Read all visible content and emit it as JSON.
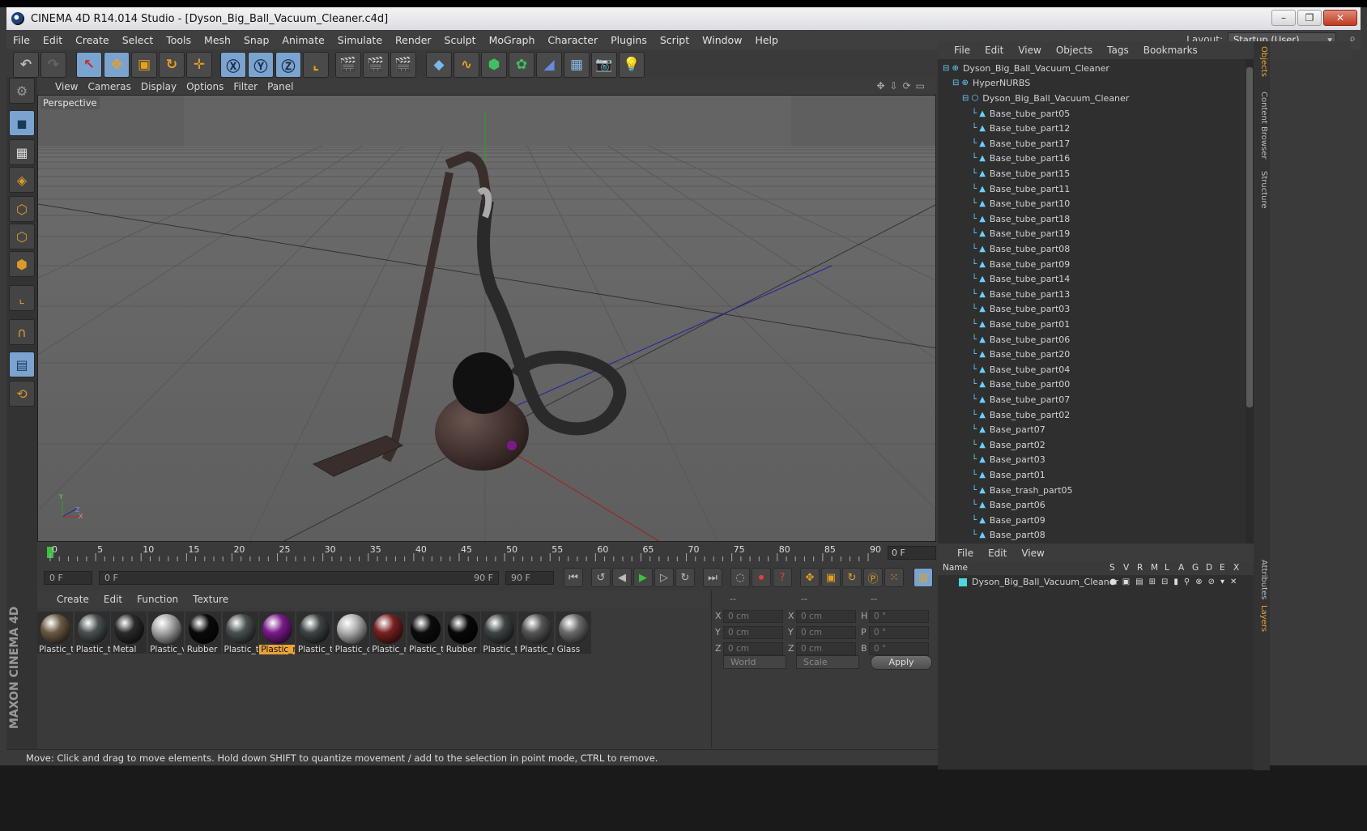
{
  "window": {
    "title": "CINEMA 4D R14.014 Studio - [Dyson_Big_Ball_Vacuum_Cleaner.c4d]",
    "buttons": [
      "–",
      "❐",
      "✕"
    ]
  },
  "menubar": {
    "items": [
      "File",
      "Edit",
      "Create",
      "Select",
      "Tools",
      "Mesh",
      "Snap",
      "Animate",
      "Simulate",
      "Render",
      "Sculpt",
      "MoGraph",
      "Character",
      "Plugins",
      "Script",
      "Window",
      "Help"
    ],
    "layout_label": "Layout:",
    "layout_value": "Startup (User)"
  },
  "viewport": {
    "menu": [
      "View",
      "Cameras",
      "Display",
      "Options",
      "Filter",
      "Panel"
    ],
    "camera_label": "Perspective",
    "axis_labels": [
      "Y",
      "Z",
      "X"
    ]
  },
  "timeline": {
    "ticks": [
      "0",
      "5",
      "10",
      "15",
      "20",
      "25",
      "30",
      "35",
      "40",
      "45",
      "50",
      "55",
      "60",
      "65",
      "70",
      "75",
      "80",
      "85",
      "90"
    ],
    "current_frame": "0 F",
    "start_field": "0 F",
    "range_start": "0 F",
    "range_end": "90 F",
    "end_field": "90 F"
  },
  "materials": {
    "menu": [
      "Create",
      "Edit",
      "Function",
      "Texture"
    ],
    "items": [
      {
        "label": "Plastic_t",
        "color": "#6a5a44"
      },
      {
        "label": "Plastic_t",
        "color": "#4a5052"
      },
      {
        "label": "Metal",
        "color": "#2a2a2a"
      },
      {
        "label": "Plastic_v",
        "color": "#a8a8a8"
      },
      {
        "label": "Rubber",
        "color": "#0a0a0a"
      },
      {
        "label": "Plastic_t",
        "color": "#4a5052"
      },
      {
        "label": "Plastic_r",
        "color": "#7a1a8a",
        "selected": true
      },
      {
        "label": "Plastic_t",
        "color": "#3e4446"
      },
      {
        "label": "Plastic_c",
        "color": "#b0b0b0"
      },
      {
        "label": "Plastic_r",
        "color": "#7a2020"
      },
      {
        "label": "Plastic_t",
        "color": "#0c0c0c"
      },
      {
        "label": "Rubber",
        "color": "#080808"
      },
      {
        "label": "Plastic_t",
        "color": "#3e4446"
      },
      {
        "label": "Plastic_r",
        "color": "#555555"
      },
      {
        "label": "Glass",
        "color": "#6a6a6a"
      }
    ]
  },
  "coordinates": {
    "headers": [
      "--",
      "--",
      "--"
    ],
    "rows": [
      {
        "a": "X",
        "av": "0 cm",
        "b": "X",
        "bv": "0 cm",
        "c": "H",
        "cv": "0 °"
      },
      {
        "a": "Y",
        "av": "0 cm",
        "b": "Y",
        "bv": "0 cm",
        "c": "P",
        "cv": "0 °"
      },
      {
        "a": "Z",
        "av": "0 cm",
        "b": "Z",
        "bv": "0 cm",
        "c": "B",
        "cv": "0 °"
      }
    ],
    "space": "World",
    "mode": "Scale",
    "apply": "Apply"
  },
  "status": "Move: Click and drag to move elements. Hold down SHIFT to quantize movement / add to the selection in point mode, CTRL to remove.",
  "objects": {
    "menu": [
      "File",
      "Edit",
      "View",
      "Objects",
      "Tags",
      "Bookmarks"
    ],
    "items": [
      {
        "name": "Dyson_Big_Ball_Vacuum_Cleaner",
        "indent": 0,
        "tag": "#4dd4e0"
      },
      {
        "name": "HyperNURBS",
        "indent": 1,
        "tag": "check"
      },
      {
        "name": "Dyson_Big_Ball_Vacuum_Cleaner",
        "indent": 2,
        "tag": ""
      },
      {
        "name": "Base_tube_part05",
        "indent": 3,
        "tag": "#444a4c"
      },
      {
        "name": "Base_tube_part12",
        "indent": 3,
        "tag": "#3c4244"
      },
      {
        "name": "Base_tube_part17",
        "indent": 3,
        "tag": "#0a0a0a"
      },
      {
        "name": "Base_tube_part16",
        "indent": 3,
        "tag": "#9a9a9a"
      },
      {
        "name": "Base_tube_part15",
        "indent": 3,
        "tag": "#0a0a0a"
      },
      {
        "name": "Base_tube_part11",
        "indent": 3,
        "tag": "#3c4244"
      },
      {
        "name": "Base_tube_part10",
        "indent": 3,
        "tag": "#3c4244"
      },
      {
        "name": "Base_tube_part18",
        "indent": 3,
        "tag": "#0a0a0a"
      },
      {
        "name": "Base_tube_part19",
        "indent": 3,
        "tag": "#7a1a8a"
      },
      {
        "name": "Base_tube_part08",
        "indent": 3,
        "tag": "#3c4244"
      },
      {
        "name": "Base_tube_part09",
        "indent": 3,
        "tag": "#7a1a8a"
      },
      {
        "name": "Base_tube_part14",
        "indent": 3,
        "tag": "#9a9a9a"
      },
      {
        "name": "Base_tube_part13",
        "indent": 3,
        "tag": "#3c4244"
      },
      {
        "name": "Base_tube_part03",
        "indent": 3,
        "tag": "#3c4244"
      },
      {
        "name": "Base_tube_part01",
        "indent": 3,
        "tag": "#9a9a9a"
      },
      {
        "name": "Base_tube_part06",
        "indent": 3,
        "tag": "#7a1a8a"
      },
      {
        "name": "Base_tube_part20",
        "indent": 3,
        "tag": "#3c4244"
      },
      {
        "name": "Base_tube_part04",
        "indent": 3,
        "tag": "#3c4244"
      },
      {
        "name": "Base_tube_part00",
        "indent": 3,
        "tag": "#9a9a9a"
      },
      {
        "name": "Base_tube_part07",
        "indent": 3,
        "tag": "#3c4244"
      },
      {
        "name": "Base_tube_part02",
        "indent": 3,
        "tag": "#0a0a0a"
      },
      {
        "name": "Base_part07",
        "indent": 3,
        "tag": "#0a0a0a"
      },
      {
        "name": "Base_part02",
        "indent": 3,
        "tag": "#0a0a0a"
      },
      {
        "name": "Base_part03",
        "indent": 3,
        "tag": "#3c4244"
      },
      {
        "name": "Base_part01",
        "indent": 3,
        "tag": "#3c4244"
      },
      {
        "name": "Base_trash_part05",
        "indent": 3,
        "tag": "#7a1a8a"
      },
      {
        "name": "Base_part06",
        "indent": 3,
        "tag": "#7a1a8a"
      },
      {
        "name": "Base_part09",
        "indent": 3,
        "tag": "#7a2020"
      },
      {
        "name": "Base_part08",
        "indent": 3,
        "tag": "#0a0a0a"
      }
    ]
  },
  "right_tabs": [
    "Objects",
    "Content Browser",
    "Structure",
    "Attributes",
    "Layers"
  ],
  "layers": {
    "menu": [
      "File",
      "Edit",
      "View"
    ],
    "columns": [
      "Name",
      "S",
      "V",
      "R",
      "M",
      "L",
      "A",
      "G",
      "D",
      "E",
      "X"
    ],
    "rows": [
      {
        "name": "Dyson_Big_Ball_Vacuum_Cleaner",
        "color": "#4dd4e0"
      }
    ]
  },
  "branding": "MAXON CINEMA 4D"
}
